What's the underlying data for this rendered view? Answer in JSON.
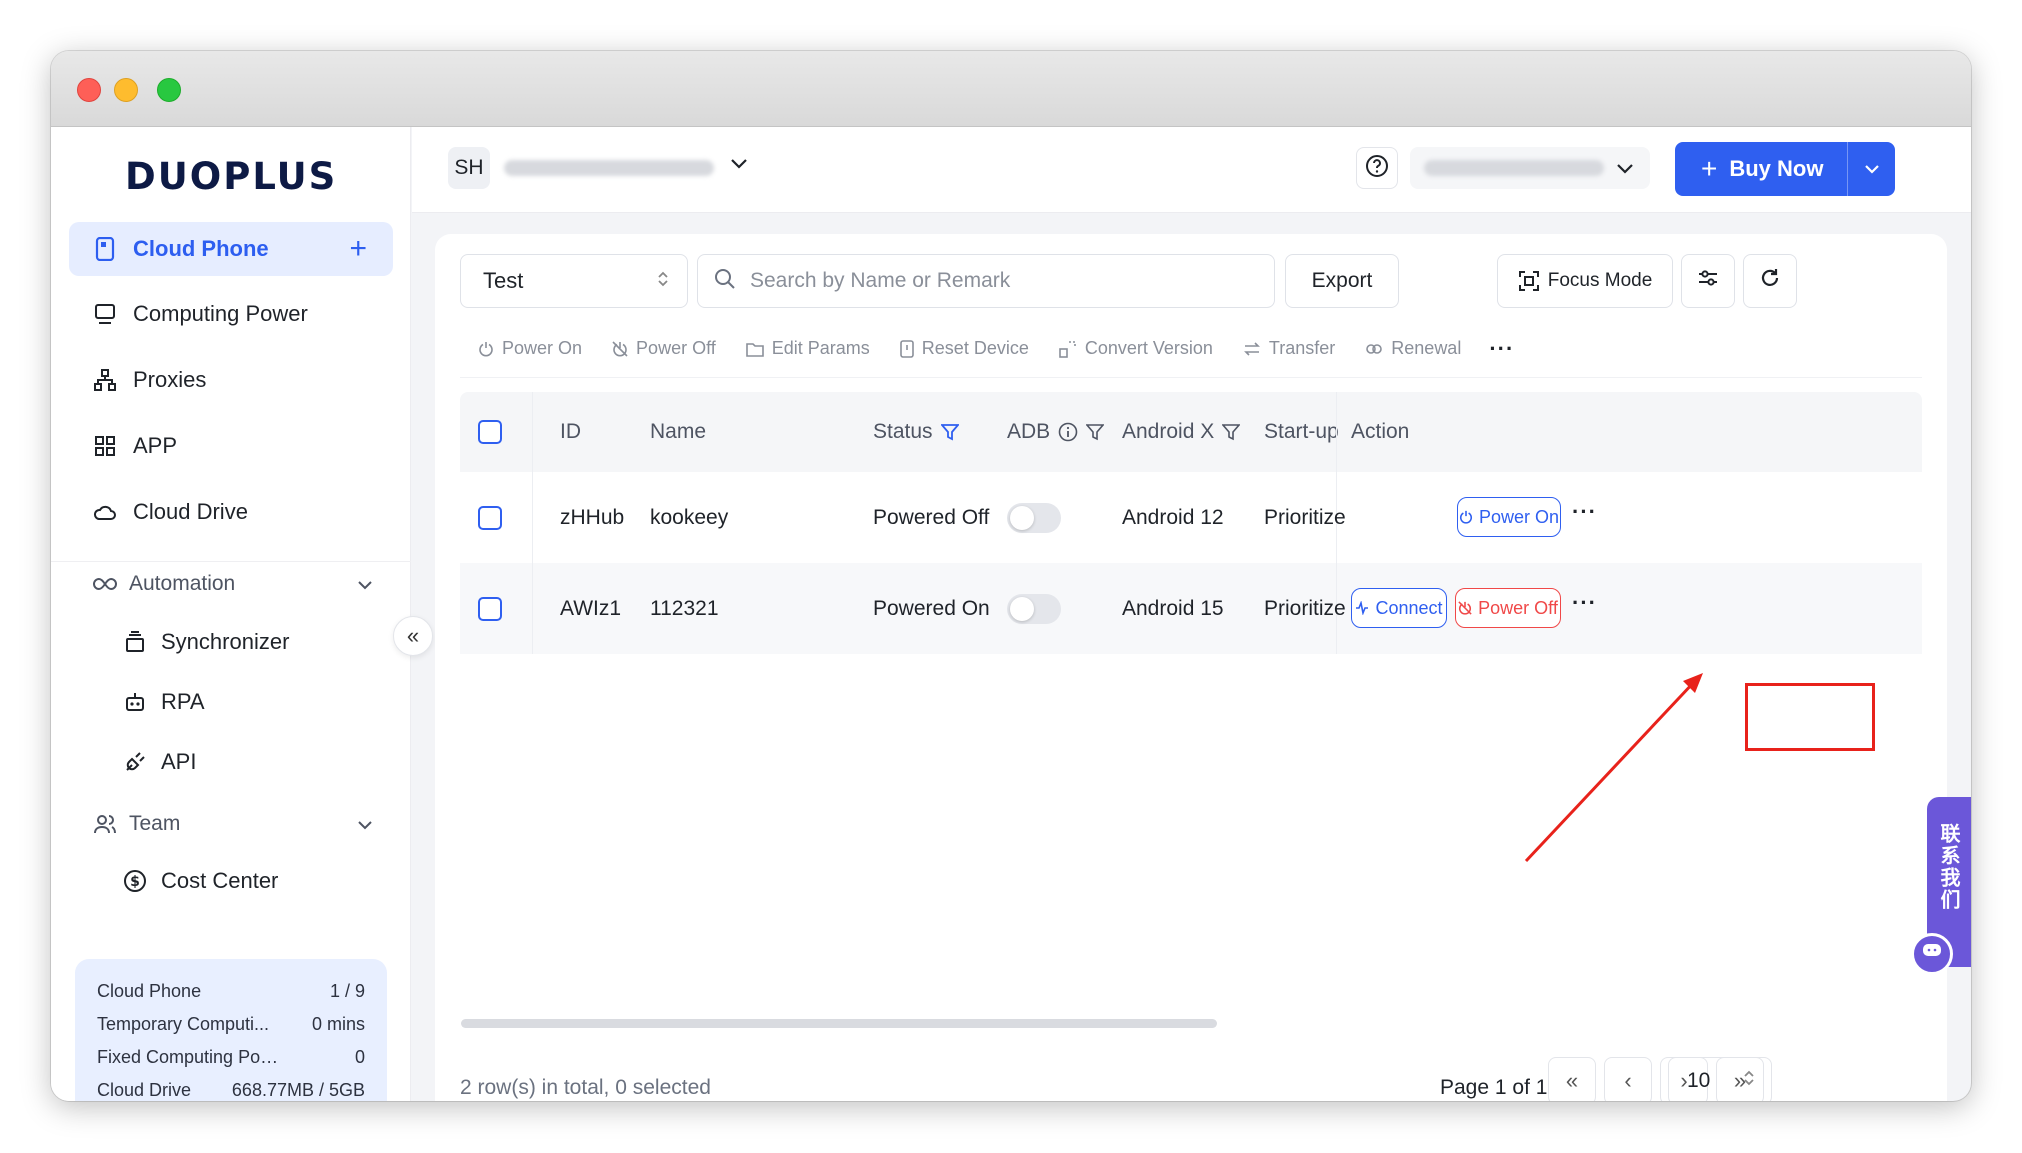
{
  "brand": {
    "logo_text": "DUOPLUS"
  },
  "sidebar": {
    "items": [
      {
        "label": "Cloud Phone",
        "icon": "phone-icon",
        "active": true
      },
      {
        "label": "Computing Power",
        "icon": "monitor-icon"
      },
      {
        "label": "Proxies",
        "icon": "network-icon"
      },
      {
        "label": "APP",
        "icon": "apps-grid-icon"
      },
      {
        "label": "Cloud Drive",
        "icon": "cloud-icon"
      }
    ],
    "automation": {
      "label": "Automation",
      "children": [
        {
          "label": "Synchronizer",
          "icon": "sync-icon"
        },
        {
          "label": "RPA",
          "icon": "robot-icon"
        },
        {
          "label": "API",
          "icon": "plug-icon"
        }
      ]
    },
    "team": {
      "label": "Team",
      "children": [
        {
          "label": "Cost Center",
          "icon": "dollar-circle-icon"
        }
      ]
    },
    "usage": [
      {
        "label": "Cloud Phone",
        "value": "1 / 9"
      },
      {
        "label": "Temporary Computi...",
        "value": "0 mins"
      },
      {
        "label": "Fixed Computing Power",
        "value": "0"
      },
      {
        "label": "Cloud Drive",
        "value": "668.77MB / 5GB"
      }
    ]
  },
  "topbar": {
    "avatar_initials": "SH",
    "buy_label": "Buy Now"
  },
  "filters": {
    "group_value": "Test",
    "search_placeholder": "Search by Name or Remark",
    "export_label": "Export",
    "focus_mode_label": "Focus Mode"
  },
  "toolbar": [
    {
      "label": "Power On",
      "icon": "power-icon"
    },
    {
      "label": "Power Off",
      "icon": "power-off-icon"
    },
    {
      "label": "Edit Params",
      "icon": "folder-edit-icon"
    },
    {
      "label": "Reset Device",
      "icon": "reset-device-icon"
    },
    {
      "label": "Convert Version",
      "icon": "convert-icon"
    },
    {
      "label": "Transfer",
      "icon": "transfer-icon"
    },
    {
      "label": "Renewal",
      "icon": "renewal-icon"
    }
  ],
  "table": {
    "columns": [
      "ID",
      "Name",
      "Status",
      "ADB",
      "Android X",
      "Start-up",
      "Action"
    ],
    "rows": [
      {
        "id": "zHHub",
        "name": "kookeey",
        "status": "Powered Off",
        "adb": false,
        "android": "Android 12",
        "startup": "Prioritize",
        "actions": [
          "Power On"
        ]
      },
      {
        "id": "AWIz1",
        "name": "112321",
        "status": "Powered On",
        "adb": false,
        "android": "Android 15",
        "startup": "Prioritize",
        "actions": [
          "Connect",
          "Power Off"
        ]
      }
    ]
  },
  "footer": {
    "summary": "2 row(s) in total, 0 selected",
    "page_label": "Page 1 of 1",
    "page_size": "10"
  },
  "contact": {
    "label": "联系我们"
  },
  "colors": {
    "accent": "#2f5ff0",
    "danger": "#f04848",
    "contact": "#6b57d9"
  }
}
